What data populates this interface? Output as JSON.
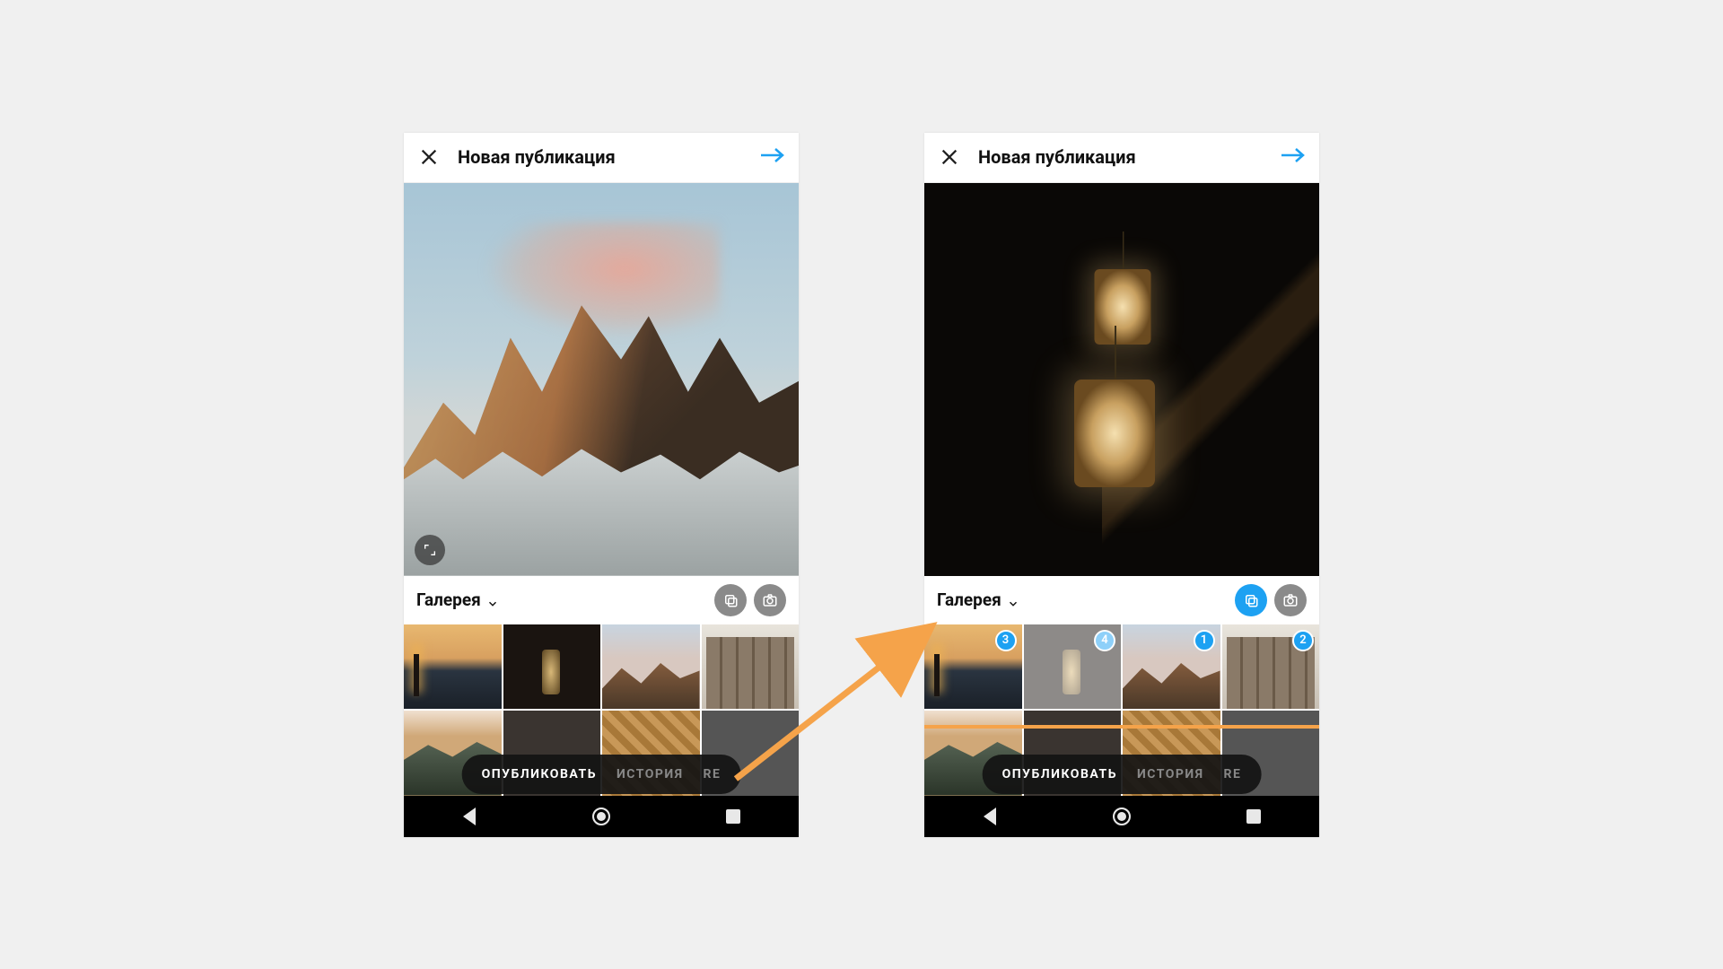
{
  "header": {
    "title": "Новая публикация"
  },
  "toolbar": {
    "gallery_label": "Галерея"
  },
  "mode_tabs": {
    "publish": "ОПУБЛИКОВАТЬ",
    "story": "ИСТОРИЯ",
    "reels_partial": "RE"
  },
  "screen_left": {
    "multi_select_active": false,
    "thumbnails": [
      {
        "scene": "bridge"
      },
      {
        "scene": "dark"
      },
      {
        "scene": "mount"
      },
      {
        "scene": "city"
      },
      {
        "scene": "hills"
      },
      {
        "scene": "shelf"
      },
      {
        "scene": "pattern"
      },
      {
        "scene": "gen"
      }
    ]
  },
  "screen_right": {
    "multi_select_active": true,
    "selected": [
      {
        "scene": "bridge",
        "order": "3"
      },
      {
        "scene": "dark",
        "order": "4",
        "dim": true
      },
      {
        "scene": "mount",
        "order": "1"
      },
      {
        "scene": "city",
        "order": "2"
      }
    ],
    "row2": [
      {
        "scene": "hills"
      },
      {
        "scene": "shelf"
      },
      {
        "scene": "pattern"
      },
      {
        "scene": "gen"
      }
    ]
  },
  "colors": {
    "accent": "#1da1f2",
    "annotation": "#f5a34a"
  }
}
